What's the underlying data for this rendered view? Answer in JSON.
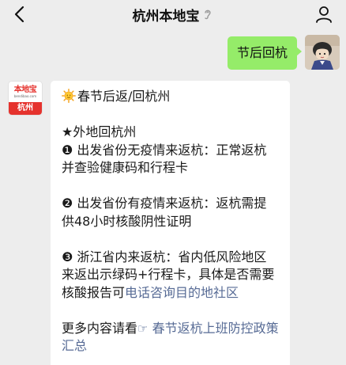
{
  "navbar": {
    "title": "杭州本地宝"
  },
  "chat": {
    "outgoing": {
      "text": "节后回杭"
    },
    "bot_avatar": {
      "brand": "本地宝",
      "domain": "bendibao.com",
      "city": "杭州"
    },
    "reply": {
      "title": "春节后返/回杭州",
      "heading": "★外地回杭州",
      "item1": "❶ 出发省份无疫情来返杭：正常返杭并查验健康码和行程卡",
      "item2": "❷ 出发省份有疫情来返杭：返杭需提供48小时核酸阴性证明",
      "item3_text": "❸ 浙江省内来返杭：省内低风险地区来返出示绿码+行程卡，具体是否需要核酸报告可",
      "item3_link": "电话咨询目的地社区",
      "more_text": "更多内容请看",
      "more_link": "春节返杭上班防控政策汇总"
    }
  },
  "colors": {
    "background": "#ededed",
    "outgoing_bubble": "#95ec69",
    "link": "#576b95",
    "brand_red": "#e5322d"
  }
}
